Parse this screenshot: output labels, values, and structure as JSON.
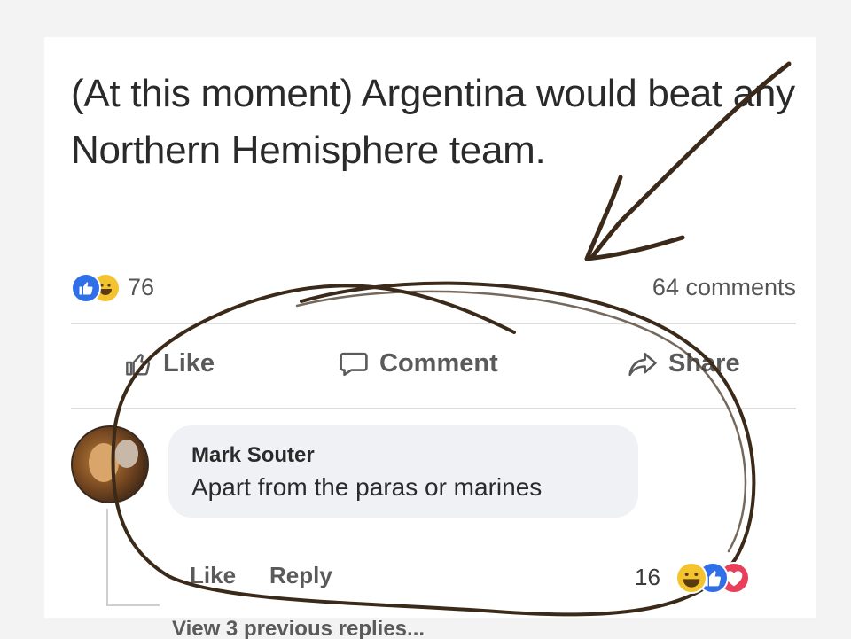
{
  "post": {
    "text": "(At this moment) Argentina would beat any Northern Hemisphere team.",
    "reaction_count": "76",
    "reaction_icons": [
      "like-icon",
      "haha-icon"
    ],
    "comments_count": "64 comments"
  },
  "actions": {
    "like_label": "Like",
    "comment_label": "Comment",
    "share_label": "Share"
  },
  "comment": {
    "author": "Mark Souter",
    "text": "Apart from the paras or marines",
    "like_label": "Like",
    "reply_label": "Reply",
    "reaction_count": "16",
    "reaction_icons": [
      "haha-icon",
      "like-icon",
      "love-icon"
    ],
    "view_replies_label": "View 3 previous replies..."
  },
  "colors": {
    "like_blue": "#2f6fe8",
    "haha_yellow": "#f4c430",
    "love_red": "#e8405a",
    "annotation_ink": "#3b2a1a"
  }
}
